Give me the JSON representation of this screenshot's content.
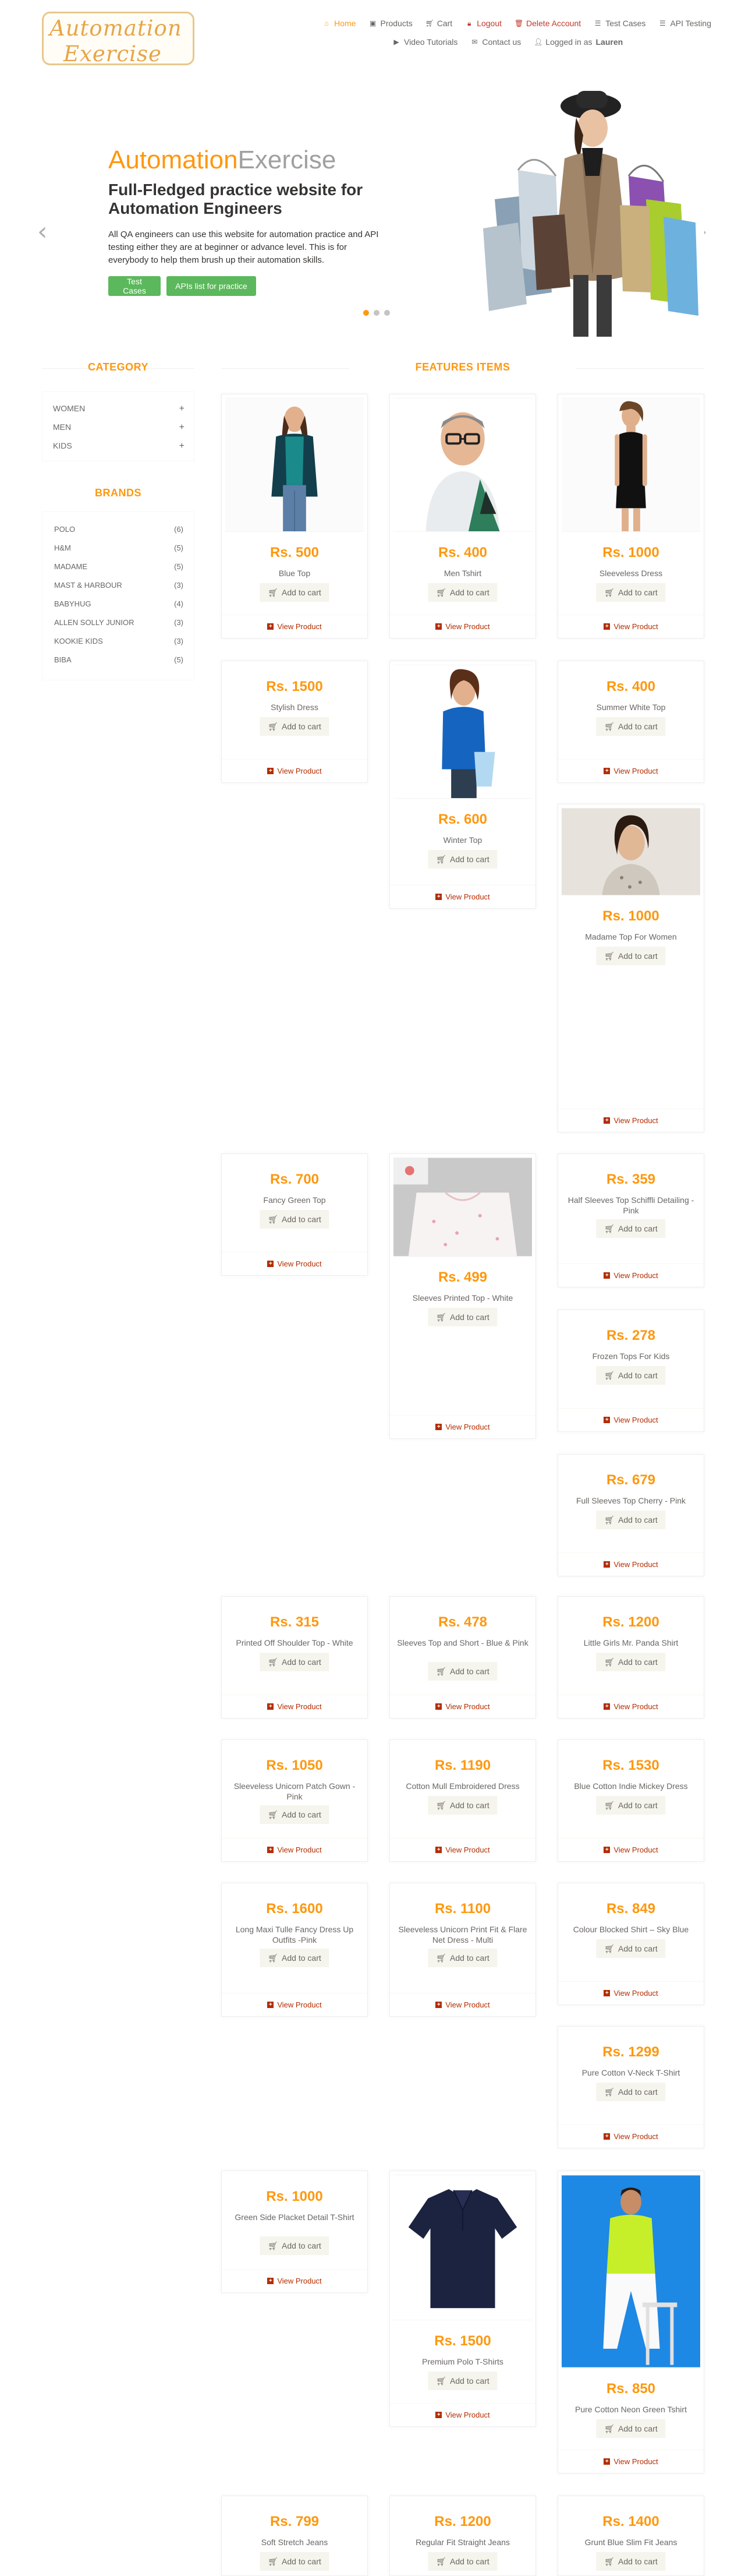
{
  "brand": {
    "logo_line1": "Automation",
    "logo_line2": "Exercise"
  },
  "nav": {
    "home": "Home",
    "products": "Products",
    "cart": "Cart",
    "logout": "Logout",
    "delete_account": "Delete Account",
    "test_cases": "Test Cases",
    "api_testing": "API Testing",
    "video_tutorials": "Video Tutorials",
    "contact_us": "Contact us",
    "logged_in_prefix": "Logged in as",
    "username": "Lauren"
  },
  "slider": {
    "title_a": "Automation",
    "title_b": "Exercise",
    "subtitle": "Full-Fledged practice website for Automation Engineers",
    "text": "All QA engineers can use this website for automation practice and API testing either they are at beginner or advance level. This is for everybody to help them brush up their automation skills.",
    "btn_test_cases": "Test Cases",
    "btn_apis": "APIs list for practice"
  },
  "sidebar": {
    "category_title": "Category",
    "categories": [
      "Women",
      "Men",
      "Kids"
    ],
    "brands_title": "Brands",
    "brands": [
      {
        "name": "Polo",
        "count": "(6)"
      },
      {
        "name": "H&M",
        "count": "(5)"
      },
      {
        "name": "Madame",
        "count": "(5)"
      },
      {
        "name": "Mast & Harbour",
        "count": "(3)"
      },
      {
        "name": "Babyhug",
        "count": "(4)"
      },
      {
        "name": "Allen Solly Junior",
        "count": "(3)"
      },
      {
        "name": "Kookie Kids",
        "count": "(3)"
      },
      {
        "name": "Biba",
        "count": "(5)"
      }
    ]
  },
  "features_title": "Features Items",
  "actions": {
    "add_to_cart": "Add to cart",
    "view_product": "View Product"
  },
  "products": [
    {
      "price": "Rs. 500",
      "name": "Blue Top"
    },
    {
      "price": "Rs. 400",
      "name": "Men Tshirt"
    },
    {
      "price": "Rs. 1000",
      "name": "Sleeveless Dress"
    },
    {
      "price": "Rs. 1500",
      "name": "Stylish Dress"
    },
    {
      "price": "Rs. 600",
      "name": "Winter Top"
    },
    {
      "price": "Rs. 400",
      "name": "Summer White Top"
    },
    {
      "price": "Rs. 1000",
      "name": "Madame Top For Women"
    },
    {
      "price": "Rs. 700",
      "name": "Fancy Green Top"
    },
    {
      "price": "Rs. 499",
      "name": "Sleeves Printed Top - White"
    },
    {
      "price": "Rs. 359",
      "name": "Half Sleeves Top Schiffli Detailing - Pink"
    },
    {
      "price": "Rs. 278",
      "name": "Frozen Tops For Kids"
    },
    {
      "price": "Rs. 679",
      "name": "Full Sleeves Top Cherry - Pink"
    },
    {
      "price": "Rs. 315",
      "name": "Printed Off Shoulder Top - White"
    },
    {
      "price": "Rs. 478",
      "name": "Sleeves Top and Short - Blue & Pink"
    },
    {
      "price": "Rs. 1200",
      "name": "Little Girls Mr. Panda Shirt"
    },
    {
      "price": "Rs. 1050",
      "name": "Sleeveless Unicorn Patch Gown - Pink"
    },
    {
      "price": "Rs. 1190",
      "name": "Cotton Mull Embroidered Dress"
    },
    {
      "price": "Rs. 1530",
      "name": "Blue Cotton Indie Mickey Dress"
    },
    {
      "price": "Rs. 1600",
      "name": "Long Maxi Tulle Fancy Dress Up Outfits -Pink"
    },
    {
      "price": "Rs. 1100",
      "name": "Sleeveless Unicorn Print Fit & Flare Net Dress - Multi"
    },
    {
      "price": "Rs. 849",
      "name": "Colour Blocked Shirt – Sky Blue"
    },
    {
      "price": "Rs. 1299",
      "name": "Pure Cotton V-Neck T-Shirt"
    },
    {
      "price": "Rs. 1000",
      "name": "Green Side Placket Detail T-Shirt"
    },
    {
      "price": "Rs. 1500",
      "name": "Premium Polo T-Shirts"
    },
    {
      "price": "Rs. 850",
      "name": "Pure Cotton Neon Green Tshirt"
    },
    {
      "price": "Rs. 799",
      "name": "Soft Stretch Jeans"
    },
    {
      "price": "Rs. 1200",
      "name": "Regular Fit Straight Jeans"
    },
    {
      "price": "Rs. 1400",
      "name": "Grunt Blue Slim Fit Jeans"
    }
  ]
}
